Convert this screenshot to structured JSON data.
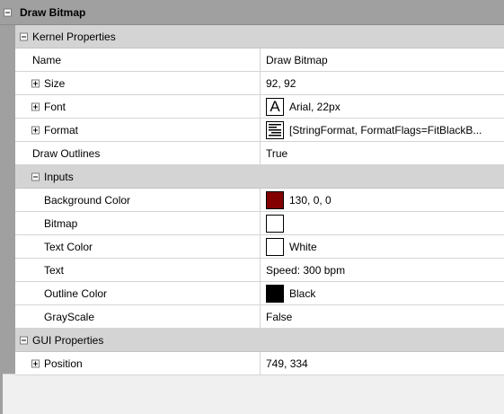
{
  "header": {
    "title": "Draw Bitmap"
  },
  "kernel": {
    "label": "Kernel Properties",
    "name": {
      "label": "Name",
      "value": "Draw Bitmap"
    },
    "size": {
      "label": "Size",
      "value": "92, 92"
    },
    "font": {
      "label": "Font",
      "icon_glyph": "A",
      "value": "Arial, 22px"
    },
    "format": {
      "label": "Format",
      "value": "[StringFormat, FormatFlags=FitBlackB..."
    },
    "draw_outlines": {
      "label": "Draw Outlines",
      "value": "True"
    }
  },
  "inputs": {
    "label": "Inputs",
    "background_color": {
      "label": "Background Color",
      "value": "130, 0, 0",
      "color": "#820000"
    },
    "bitmap": {
      "label": "Bitmap",
      "value": "",
      "color": "#ffffff"
    },
    "text_color": {
      "label": "Text Color",
      "value": "White",
      "color": "#ffffff"
    },
    "text": {
      "label": "Text",
      "value": "Speed: 300 bpm"
    },
    "outline_color": {
      "label": "Outline Color",
      "value": "Black",
      "color": "#000000"
    },
    "grayscale": {
      "label": "GrayScale",
      "value": "False"
    }
  },
  "gui": {
    "label": "GUI Properties",
    "position": {
      "label": "Position",
      "value": "749, 334"
    }
  }
}
